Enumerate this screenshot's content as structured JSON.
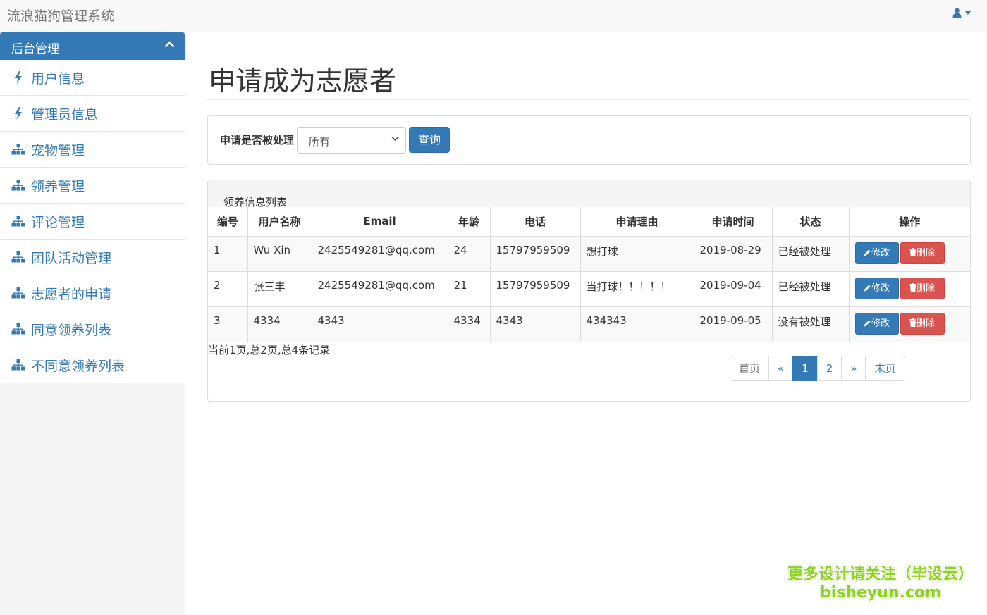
{
  "app": {
    "title": "流浪猫狗管理系统"
  },
  "sidebar": {
    "header": "后台管理",
    "items": [
      {
        "label": "用户信息",
        "icon": "bolt-icon"
      },
      {
        "label": "管理员信息",
        "icon": "bolt-icon"
      },
      {
        "label": "宠物管理",
        "icon": "sitemap-icon"
      },
      {
        "label": "领养管理",
        "icon": "sitemap-icon"
      },
      {
        "label": "评论管理",
        "icon": "sitemap-icon"
      },
      {
        "label": "团队活动管理",
        "icon": "sitemap-icon"
      },
      {
        "label": "志愿者的申请",
        "icon": "sitemap-icon"
      },
      {
        "label": "同意领养列表",
        "icon": "sitemap-icon"
      },
      {
        "label": "不同意领养列表",
        "icon": "sitemap-icon"
      }
    ]
  },
  "main": {
    "title": "申请成为志愿者",
    "filter": {
      "label": "申请是否被处理",
      "selected": "所有",
      "query_label": "查询"
    },
    "list": {
      "heading": "领养信息列表",
      "columns": [
        "编号",
        "用户名称",
        "Email",
        "年龄",
        "电话",
        "申请理由",
        "申请时间",
        "状态",
        "操作"
      ],
      "rows": [
        [
          "1",
          "Wu Xin",
          "2425549281@qq.com",
          "24",
          "15797959509",
          "想打球",
          "2019-08-29",
          "已经被处理"
        ],
        [
          "2",
          "张三丰",
          "2425549281@qq.com",
          "21",
          "15797959509",
          "当打球！！！！！",
          "2019-09-04",
          "已经被处理"
        ],
        [
          "3",
          "4334",
          "4343",
          "4334",
          "4343",
          "434343",
          "2019-09-05",
          "没有被处理"
        ]
      ],
      "edit_label": "修改",
      "delete_label": "删除",
      "records_text": "当前1页,总2页,总4条记录"
    },
    "pager": {
      "first": "首页",
      "prev": "«",
      "pages": [
        "1",
        "2"
      ],
      "current": "1",
      "next": "»",
      "last": "末页"
    }
  },
  "watermark": {
    "line1": "更多设计请关注（毕设云）",
    "line2": "bisheyun.com"
  },
  "colors": {
    "primary": "#337ab7",
    "danger": "#d9534f",
    "watermark": "#8cd31c"
  }
}
